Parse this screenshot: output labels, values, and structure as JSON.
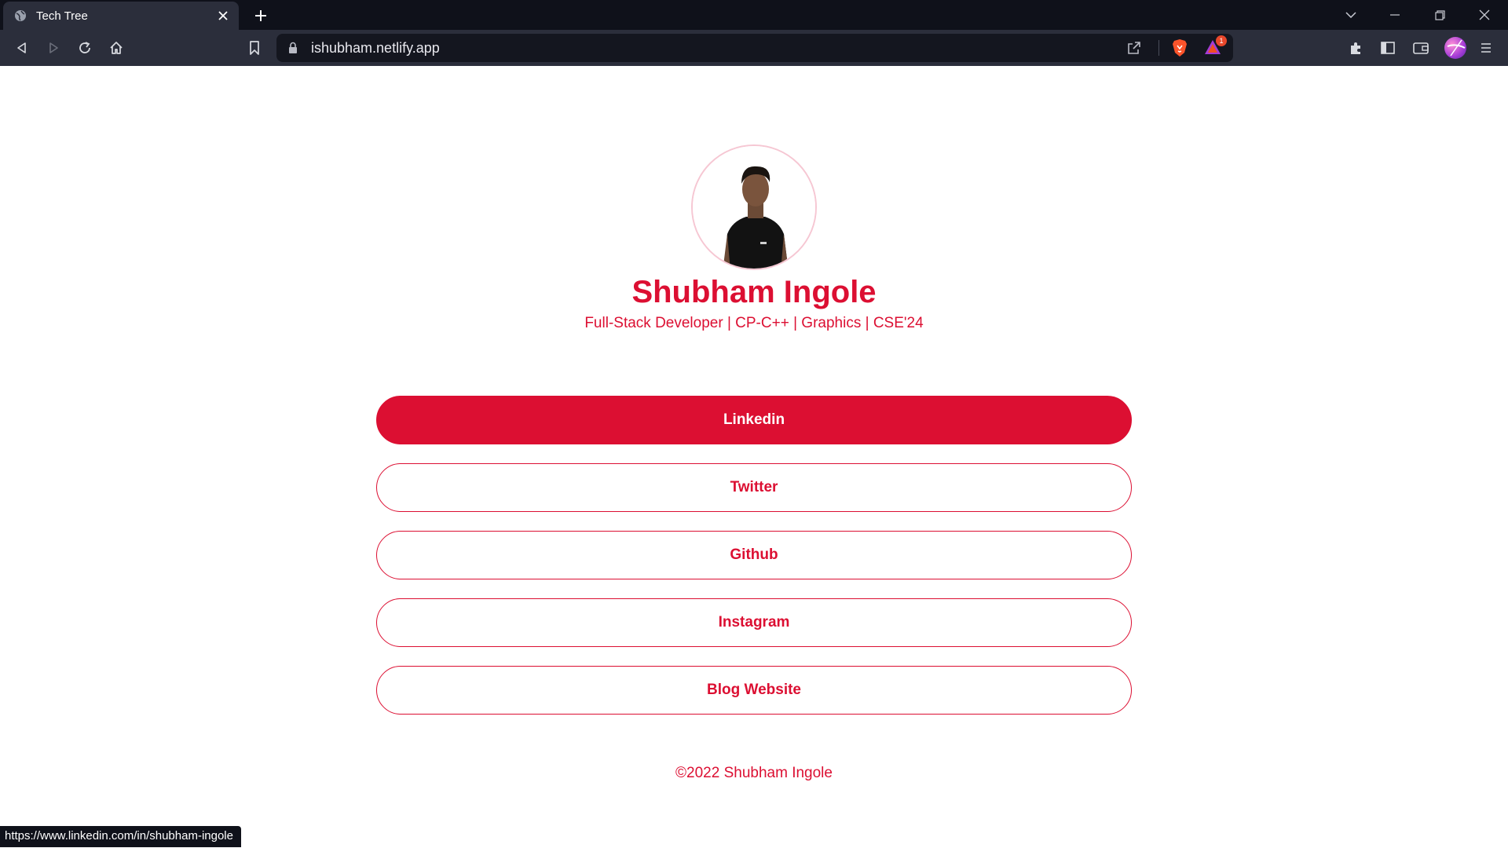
{
  "browser": {
    "tab_title": "Tech Tree",
    "url": "ishubham.netlify.app",
    "rewards_badge": "1",
    "status_url": "https://www.linkedin.com/in/shubham-ingole"
  },
  "profile": {
    "name": "Shubham Ingole",
    "tagline": "Full-Stack Developer | CP-C++ | Graphics | CSE'24"
  },
  "links": [
    {
      "label": "Linkedin"
    },
    {
      "label": "Twitter"
    },
    {
      "label": "Github"
    },
    {
      "label": "Instagram"
    },
    {
      "label": "Blog Website"
    }
  ],
  "footer": {
    "text": "©2022 Shubham Ingole"
  },
  "colors": {
    "accent": "#dc0f32",
    "chrome_dark": "#0f111a",
    "chrome_toolbar": "#2b2e3b"
  }
}
